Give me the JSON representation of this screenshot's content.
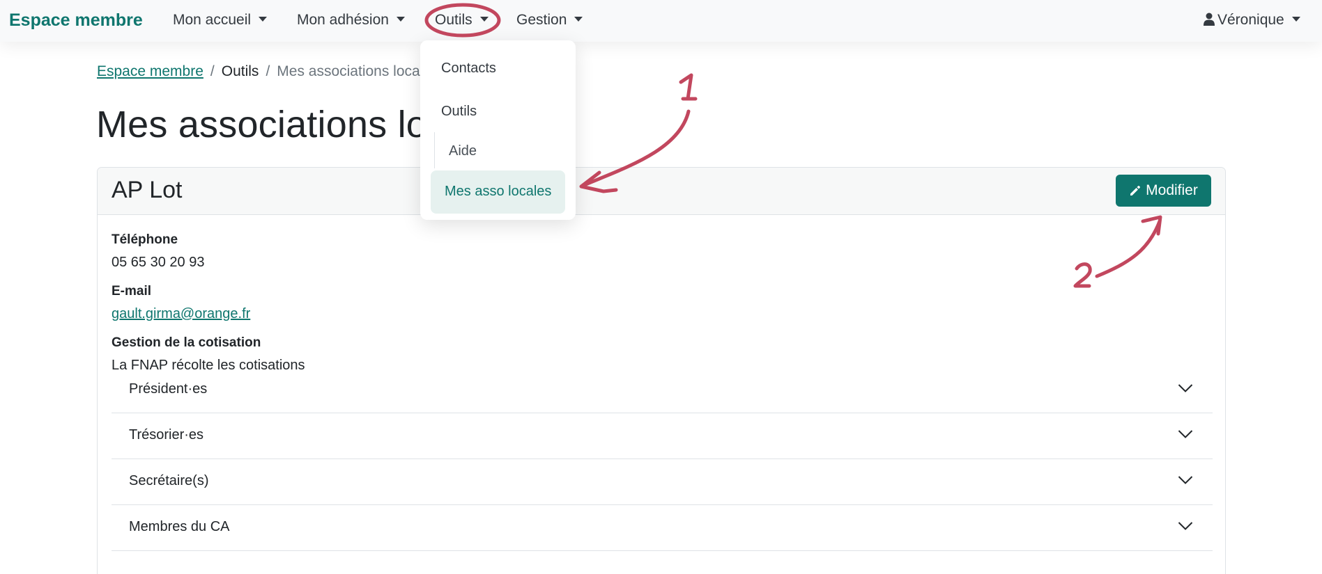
{
  "navbar": {
    "brand": "Espace membre",
    "items": [
      {
        "label": "Mon accueil"
      },
      {
        "label": "Mon adhésion"
      },
      {
        "label": "Outils"
      },
      {
        "label": "Gestion"
      }
    ],
    "user": "Véronique"
  },
  "dropdown": {
    "items": [
      "Contacts",
      "Outils",
      "Aide"
    ],
    "active": "Mes asso locales"
  },
  "breadcrumb": {
    "home": "Espace membre",
    "section": "Outils",
    "current": "Mes associations loca"
  },
  "page": {
    "title": "Mes associations lo"
  },
  "card": {
    "title": "AP Lot",
    "edit_button": "Modifier",
    "fields": [
      {
        "label": "Téléphone",
        "value": "05 65 30 20 93"
      },
      {
        "label": "E-mail",
        "value": "gault.girma@orange.fr"
      },
      {
        "label": "Gestion de la cotisation",
        "value": "La FNAP récolte les cotisations"
      }
    ],
    "accordion": [
      "Président·es",
      "Trésorier·es",
      "Secrétaire(s)",
      "Membres du CA"
    ]
  },
  "annotations": {
    "one": "1",
    "two": "2",
    "color": "#c2475e"
  },
  "colors": {
    "accent": "#0f766e",
    "navbar_bg": "#f8f9fa",
    "active_bg": "#e6f1ef"
  },
  "icons": [
    "user-icon",
    "pencil-icon",
    "chevron-down-icon",
    "caret-down-icon"
  ]
}
